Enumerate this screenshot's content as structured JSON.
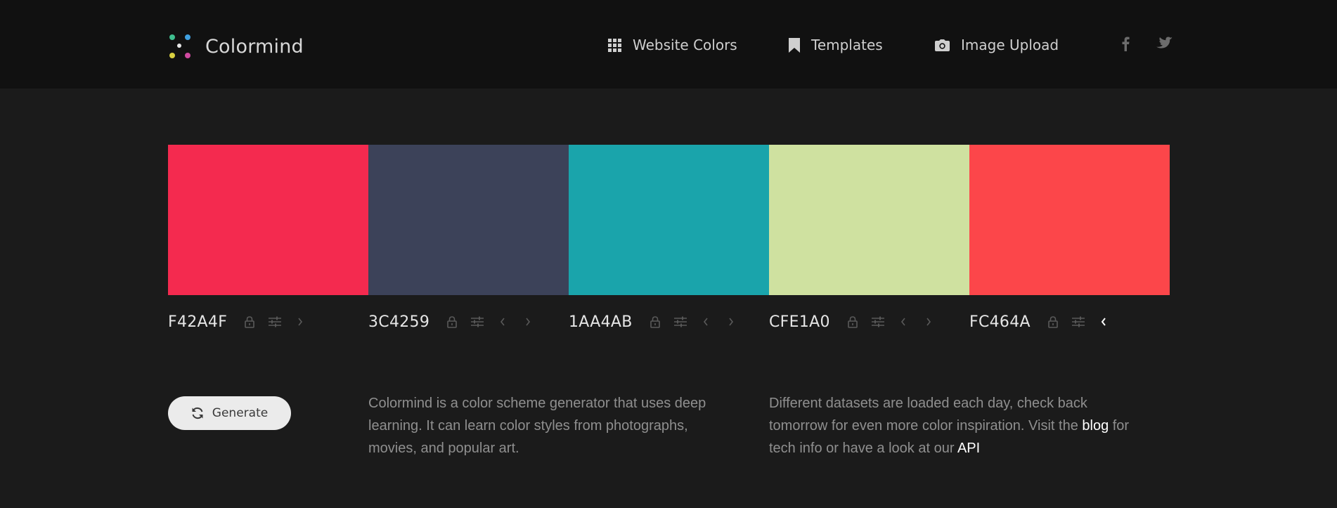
{
  "header": {
    "brand": "Colormind",
    "nav": [
      {
        "label": "Website Colors",
        "icon": "grid-icon"
      },
      {
        "label": "Templates",
        "icon": "bookmark-icon"
      },
      {
        "label": "Image Upload",
        "icon": "camera-icon"
      }
    ],
    "social": [
      {
        "icon": "facebook-icon"
      },
      {
        "icon": "twitter-icon"
      }
    ]
  },
  "palette": [
    {
      "hex": "F42A4F",
      "color": "#F42A4F"
    },
    {
      "hex": "3C4259",
      "color": "#3C4259"
    },
    {
      "hex": "1AA4AB",
      "color": "#1AA4AB"
    },
    {
      "hex": "CFE1A0",
      "color": "#CFE1A0"
    },
    {
      "hex": "FC464A",
      "color": "#FC464A"
    }
  ],
  "generate": {
    "label": "Generate",
    "icon": "refresh-icon"
  },
  "about": {
    "text": "Colormind is a color scheme generator that uses deep learning. It can learn color styles from photographs, movies, and popular art."
  },
  "datasets": {
    "text_before": "Different datasets are loaded each day, check back tomorrow for even more color inspiration. Visit the ",
    "blog_label": "blog",
    "text_middle": " for tech info or have a look at our ",
    "api_label": "API"
  },
  "colors": {
    "header_bg": "#111111",
    "page_bg": "#1b1b1b",
    "button_bg": "#ebebeb",
    "muted_text": "#8f8f8f"
  }
}
